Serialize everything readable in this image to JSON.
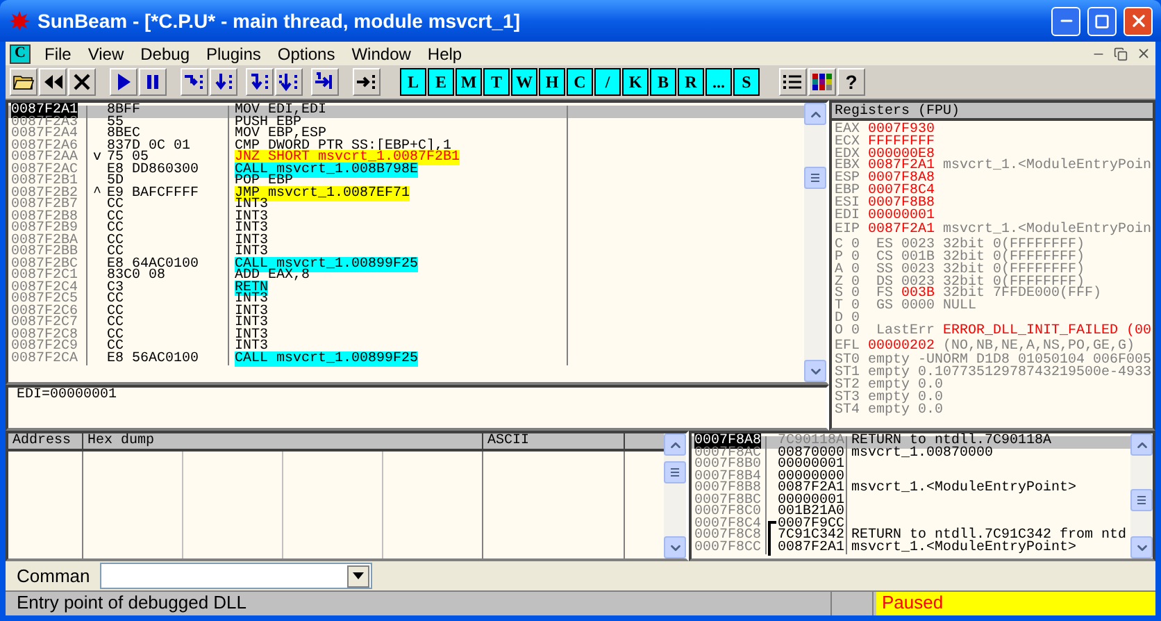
{
  "window": {
    "title": "SunBeam - [*C.P.U* - main thread, module msvcrt_1]"
  },
  "menu_bar": {
    "doc_icon": "C",
    "items": [
      "File",
      "View",
      "Debug",
      "Plugins",
      "Options",
      "Window",
      "Help"
    ]
  },
  "toolbar": {
    "letter_buttons": [
      "L",
      "E",
      "M",
      "T",
      "W",
      "H",
      "C",
      "/",
      "K",
      "B",
      "R",
      "...",
      "S"
    ],
    "help": "?"
  },
  "disassembly": {
    "rows": [
      {
        "address": "0087F2A1",
        "mark": "",
        "hex": "8BFF",
        "command": "MOV EDI,EDI",
        "kind": "plain",
        "selected": true
      },
      {
        "address": "0087F2A3",
        "mark": "",
        "hex": "55",
        "command": "PUSH EBP",
        "kind": "plain",
        "selected": false
      },
      {
        "address": "0087F2A4",
        "mark": "",
        "hex": "8BEC",
        "command": "MOV EBP,ESP",
        "kind": "plain",
        "selected": false
      },
      {
        "address": "0087F2A6",
        "mark": "",
        "hex": "837D 0C 01",
        "command": "CMP DWORD PTR SS:[EBP+C],1",
        "kind": "plain",
        "selected": false
      },
      {
        "address": "0087F2AA",
        "mark": "v",
        "hex": "75 05",
        "command": "JNZ SHORT msvcrt_1.0087F2B1",
        "kind": "cond_jump",
        "selected": false
      },
      {
        "address": "0087F2AC",
        "mark": "",
        "hex": "E8 DD860300",
        "command": "CALL msvcrt_1.008B798E",
        "kind": "call",
        "selected": false
      },
      {
        "address": "0087F2B1",
        "mark": "",
        "hex": "5D",
        "command": "POP EBP",
        "kind": "plain",
        "selected": false
      },
      {
        "address": "0087F2B2",
        "mark": "^",
        "hex": "E9 BAFCFFFF",
        "command": "JMP msvcrt_1.0087EF71",
        "kind": "jump",
        "selected": false
      },
      {
        "address": "0087F2B7",
        "mark": "",
        "hex": "CC",
        "command": "INT3",
        "kind": "plain",
        "selected": false
      },
      {
        "address": "0087F2B8",
        "mark": "",
        "hex": "CC",
        "command": "INT3",
        "kind": "plain",
        "selected": false
      },
      {
        "address": "0087F2B9",
        "mark": "",
        "hex": "CC",
        "command": "INT3",
        "kind": "plain",
        "selected": false
      },
      {
        "address": "0087F2BA",
        "mark": "",
        "hex": "CC",
        "command": "INT3",
        "kind": "plain",
        "selected": false
      },
      {
        "address": "0087F2BB",
        "mark": "",
        "hex": "CC",
        "command": "INT3",
        "kind": "plain",
        "selected": false
      },
      {
        "address": "0087F2BC",
        "mark": "",
        "hex": "E8 64AC0100",
        "command": "CALL msvcrt_1.00899F25",
        "kind": "call",
        "selected": false
      },
      {
        "address": "0087F2C1",
        "mark": "",
        "hex": "83C0 08",
        "command": "ADD EAX,8",
        "kind": "plain",
        "selected": false
      },
      {
        "address": "0087F2C4",
        "mark": "",
        "hex": "C3",
        "command": "RETN",
        "kind": "ret",
        "selected": false
      },
      {
        "address": "0087F2C5",
        "mark": "",
        "hex": "CC",
        "command": "INT3",
        "kind": "plain",
        "selected": false
      },
      {
        "address": "0087F2C6",
        "mark": "",
        "hex": "CC",
        "command": "INT3",
        "kind": "plain",
        "selected": false
      },
      {
        "address": "0087F2C7",
        "mark": "",
        "hex": "CC",
        "command": "INT3",
        "kind": "plain",
        "selected": false
      },
      {
        "address": "0087F2C8",
        "mark": "",
        "hex": "CC",
        "command": "INT3",
        "kind": "plain",
        "selected": false
      },
      {
        "address": "0087F2C9",
        "mark": "",
        "hex": "CC",
        "command": "INT3",
        "kind": "plain",
        "selected": false
      },
      {
        "address": "0087F2CA",
        "mark": "",
        "hex": "E8 56AC0100",
        "command": "CALL msvcrt_1.00899F25",
        "kind": "call",
        "selected": false
      }
    ]
  },
  "info": "EDI=00000001",
  "registers": {
    "title": "Registers (FPU)",
    "general": [
      {
        "name": "EAX",
        "value": "0007F930",
        "changed": true
      },
      {
        "name": "ECX",
        "value": "FFFFFFFF",
        "changed": true
      },
      {
        "name": "EDX",
        "value": "000000E8",
        "changed": true
      },
      {
        "name": "EBX",
        "value": "0087F2A1",
        "changed": true,
        "comment": "msvcrt_1.<ModuleEntryPoin"
      },
      {
        "name": "ESP",
        "value": "0007F8A8",
        "changed": true
      },
      {
        "name": "EBP",
        "value": "0007F8C4",
        "changed": true
      },
      {
        "name": "ESI",
        "value": "0007F8B8",
        "changed": true
      },
      {
        "name": "EDI",
        "value": "00000001",
        "changed": true
      }
    ],
    "eip": {
      "name": "EIP",
      "value": "0087F2A1",
      "changed": true,
      "comment": "msvcrt_1.<ModuleEntryPoin"
    },
    "flags": [
      {
        "flag": "C 0",
        "reg": "ES",
        "value": "0023",
        "changed": false,
        "info": "32bit 0(FFFFFFFF)"
      },
      {
        "flag": "P 0",
        "reg": "CS",
        "value": "001B",
        "changed": false,
        "info": "32bit 0(FFFFFFFF)"
      },
      {
        "flag": "A 0",
        "reg": "SS",
        "value": "0023",
        "changed": false,
        "info": "32bit 0(FFFFFFFF)"
      },
      {
        "flag": "Z 0",
        "reg": "DS",
        "value": "0023",
        "changed": false,
        "info": "32bit 0(FFFFFFFF)"
      },
      {
        "flag": "S 0",
        "reg": "FS",
        "value": "003B",
        "changed": true,
        "info": "32bit 7FFDE000(FFF)"
      },
      {
        "flag": "T 0",
        "reg": "GS",
        "value": "0000",
        "changed": false,
        "info": "NULL"
      },
      {
        "flag": "D 0"
      },
      {
        "flag": "O 0",
        "reg": "LastErr",
        "value": "ERROR_DLL_INIT_FAILED (00",
        "changed": true
      }
    ],
    "efl": {
      "name": "EFL",
      "value": "00000202",
      "changed": true,
      "comment": "(NO,NB,NE,A,NS,PO,GE,G)"
    },
    "fpu": [
      {
        "name": "ST0",
        "tag": "empty",
        "value": "-UNORM D1D8 01050104 006F005"
      },
      {
        "name": "ST1",
        "tag": "empty",
        "value": "0.10773512978743219500e-4933"
      },
      {
        "name": "ST2",
        "tag": "empty",
        "value": "0.0"
      },
      {
        "name": "ST3",
        "tag": "empty",
        "value": "0.0"
      },
      {
        "name": "ST4",
        "tag": "empty",
        "value": "0.0"
      }
    ]
  },
  "dump": {
    "columns": [
      "Address",
      "Hex dump",
      "ASCII"
    ]
  },
  "stack": {
    "rows": [
      {
        "address": "0007F8A8",
        "value": "7C90118A",
        "comment": "RETURN to ntdll.7C90118A",
        "in_frame": false,
        "frame_start": false,
        "selected": true
      },
      {
        "address": "0007F8AC",
        "value": "00870000",
        "comment": "msvcrt_1.00870000",
        "in_frame": false,
        "frame_start": false,
        "selected": false
      },
      {
        "address": "0007F8B0",
        "value": "00000001",
        "in_frame": false,
        "frame_start": false,
        "selected": false
      },
      {
        "address": "0007F8B4",
        "value": "00000000",
        "in_frame": false,
        "frame_start": false,
        "selected": false
      },
      {
        "address": "0007F8B8",
        "value": "0087F2A1",
        "comment": "msvcrt_1.<ModuleEntryPoint>",
        "in_frame": false,
        "frame_start": false,
        "selected": false
      },
      {
        "address": "0007F8BC",
        "value": "00000001",
        "in_frame": false,
        "frame_start": false,
        "selected": false
      },
      {
        "address": "0007F8C0",
        "value": "001B21A0",
        "in_frame": false,
        "frame_start": false,
        "selected": false
      },
      {
        "address": "0007F8C4",
        "value": "0007F9CC",
        "in_frame": true,
        "frame_start": true,
        "selected": false
      },
      {
        "address": "0007F8C8",
        "value": "7C91C342",
        "comment": "RETURN to ntdll.7C91C342 from ntd",
        "in_frame": true,
        "frame_start": false,
        "selected": false
      },
      {
        "address": "0007F8CC",
        "value": "0087F2A1",
        "comment": "msvcrt_1.<ModuleEntryPoint>",
        "in_frame": true,
        "frame_start": false,
        "selected": false
      }
    ]
  },
  "command_bar": {
    "label": "Comman"
  },
  "status_bar": {
    "message": "Entry point of debugged DLL",
    "state": "Paused"
  }
}
